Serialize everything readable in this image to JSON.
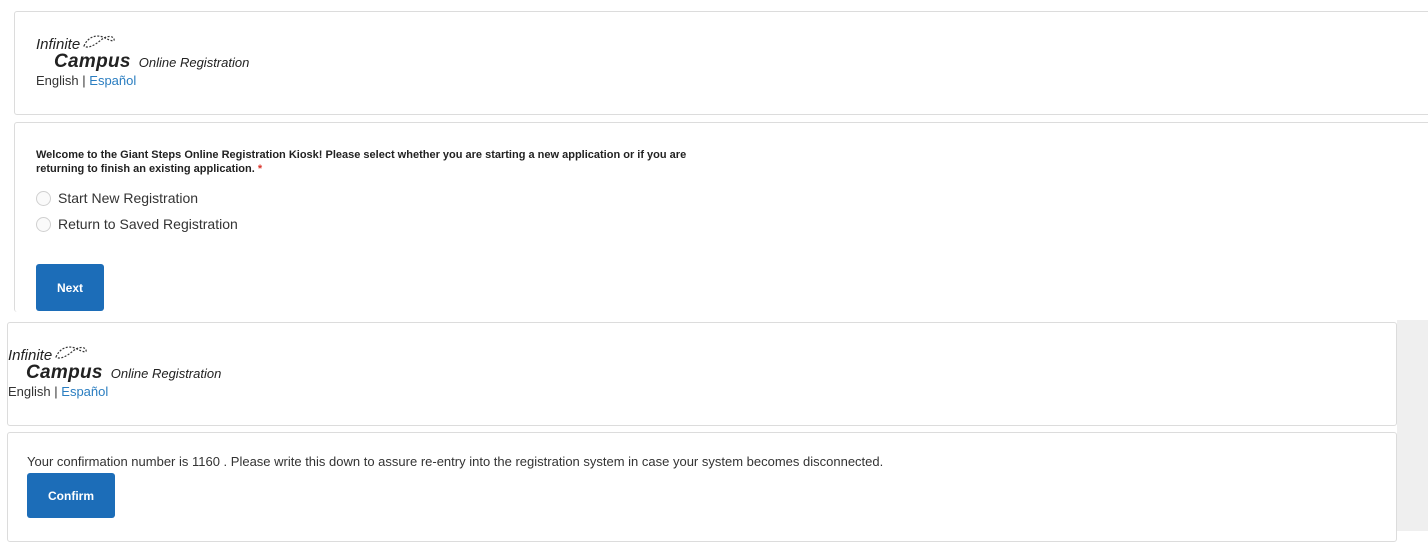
{
  "header_top": {
    "logo_infinite": "Infinite",
    "logo_campus": "Campus",
    "logo_subtitle": "Online Registration",
    "lang_english": "English",
    "lang_separator": "|",
    "lang_spanish": "Español"
  },
  "kiosk": {
    "prompt": "Welcome to the Giant Steps Online Registration Kiosk! Please select whether you are starting a new application or if you are returning to finish an existing application.",
    "required_mark": "*",
    "option_new": "Start New Registration",
    "option_return": "Return to Saved Registration",
    "next_label": "Next"
  },
  "header_bottom": {
    "logo_infinite": "Infinite",
    "logo_campus": "Campus",
    "logo_subtitle": "Online Registration",
    "lang_english": "English",
    "lang_separator": "|",
    "lang_spanish": "Español"
  },
  "confirmation": {
    "message": "Your confirmation number is 1160 . Please write this down to assure re-entry into the registration system in case your system becomes disconnected.",
    "confirm_label": "Confirm"
  },
  "colors": {
    "button": "#1c6db8",
    "link": "#2a7dc0",
    "required": "#d9342b"
  }
}
